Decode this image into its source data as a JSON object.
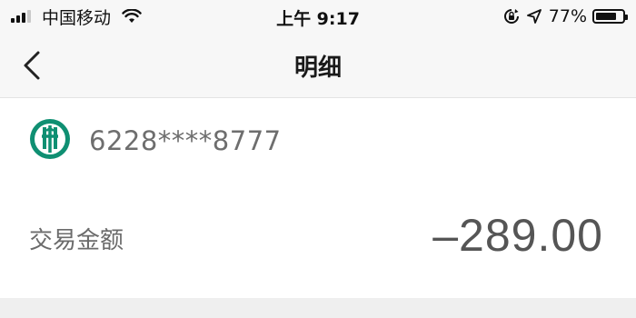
{
  "status_bar": {
    "carrier": "中国移动",
    "time": "上午 9:17",
    "battery_percent_text": "77%",
    "battery_level": 0.77,
    "icons": [
      "signal-icon",
      "wifi-icon",
      "orientation-lock-icon",
      "location-icon",
      "battery-icon"
    ]
  },
  "nav": {
    "title": "明细",
    "back_icon": "chevron-left-icon"
  },
  "account": {
    "bank_logo": "abc-bank-logo",
    "card_number": "6228****8777"
  },
  "transaction": {
    "amount_label": "交易金额",
    "amount_value": "–289.00"
  },
  "colors": {
    "bank_green": "#0f8f72",
    "text_primary": "#1a1a1a",
    "text_secondary": "#6b6b6b",
    "amount": "#555555",
    "header_bg": "#f7f7f7"
  }
}
